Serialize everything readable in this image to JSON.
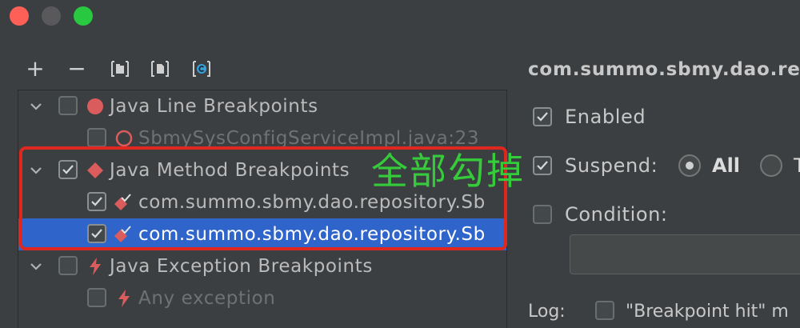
{
  "window": {
    "controls": [
      "close",
      "minimize",
      "zoom"
    ]
  },
  "toolbar": {
    "add_symbol": "+",
    "remove_symbol": "−",
    "buttons": [
      "add-icon",
      "remove-icon",
      "group-by-package-icon",
      "group-by-file-icon",
      "group-by-class-icon"
    ]
  },
  "tree": {
    "rows": [
      {
        "label": "Java Line Breakpoints",
        "checked": false,
        "dim": false,
        "icon": "line-breakpoint-icon"
      },
      {
        "label": "SbmySysConfigServiceImpl.java:23",
        "checked": false,
        "dim": true,
        "icon": "disabled-breakpoint-icon"
      },
      {
        "label": "Java Method Breakpoints",
        "checked": true,
        "dim": false,
        "icon": "method-breakpoint-icon"
      },
      {
        "label": "com.summo.sbmy.dao.repository.Sb",
        "checked": true,
        "dim": false,
        "icon": "method-breakpoint-checked-icon"
      },
      {
        "label": "com.summo.sbmy.dao.repository.Sb",
        "checked": true,
        "dim": false,
        "selected": true,
        "icon": "method-breakpoint-checked-icon"
      },
      {
        "label": "Java Exception Breakpoints",
        "checked": false,
        "dim": false,
        "icon": "exception-breakpoint-icon"
      },
      {
        "label": "Any exception",
        "checked": false,
        "dim": true,
        "icon": "exception-breakpoint-icon"
      }
    ]
  },
  "annotation": {
    "text": "全部勾掉",
    "box_color": "#e0271f",
    "text_color": "#35cb3a"
  },
  "details": {
    "title": "com.summo.sbmy.dao.re",
    "enabled_label": "Enabled",
    "enabled_checked": true,
    "suspend_label": "Suspend:",
    "suspend_checked": true,
    "suspend_options": [
      "All",
      "T"
    ],
    "suspend_selected": "All",
    "condition_label": "Condition:",
    "condition_checked": false,
    "condition_value": "",
    "log_label": "Log:",
    "log_text": "\"Breakpoint hit\" m",
    "log_checked": false
  },
  "colors": {
    "background": "#3c3f41",
    "selection": "#2f65ca",
    "breakpoint_red": "#db5c5c"
  }
}
